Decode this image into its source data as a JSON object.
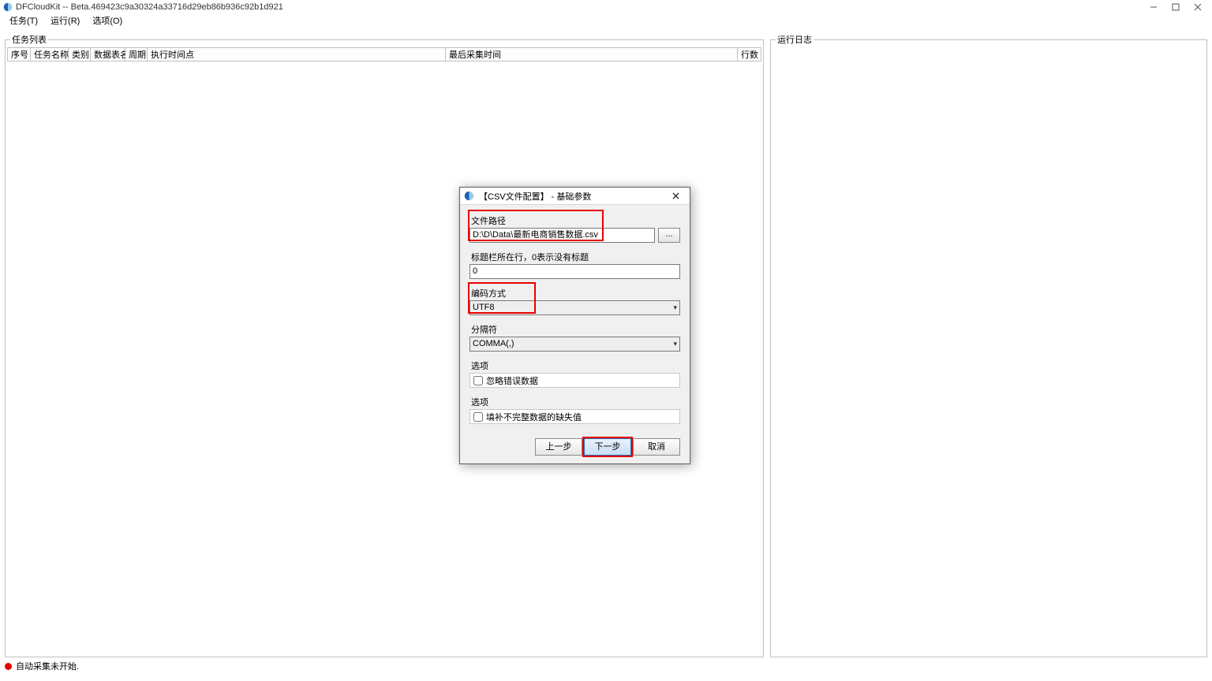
{
  "window": {
    "title": "DFCloudKit -- Beta.469423c9a30324a33716d29eb86b936c92b1d921"
  },
  "menu": {
    "task": "任务(T)",
    "run": "运行(R)",
    "options": "选项(O)"
  },
  "panels": {
    "tasklist_title": "任务列表",
    "log_title": "运行日志"
  },
  "table": {
    "seq": "序号",
    "name": "任务名称",
    "cat": "类别",
    "table": "数据表名",
    "cycle": "周期",
    "exec": "执行时间点",
    "last": "最后采集时间",
    "rows": "行数"
  },
  "status": {
    "text": "自动采集未开始."
  },
  "dialog": {
    "title": "【CSV文件配置】 - 基础参数",
    "file_label": "文件路径",
    "file_value": "D:\\D\\Data\\最新电商销售数据.csv",
    "browse": "...",
    "titlerow_label": "标题栏所在行，0表示没有标题",
    "titlerow_value": "0",
    "encoding_label": "编码方式",
    "encoding_value": "UTF8",
    "delimiter_label": "分隔符",
    "delimiter_value": "COMMA(,)",
    "opt1_header": "选项",
    "opt1_label": "忽略错误数据",
    "opt2_header": "选项",
    "opt2_label": "填补不完整数据的缺失值",
    "prev": "上一步",
    "next": "下一步",
    "cancel": "取消"
  }
}
